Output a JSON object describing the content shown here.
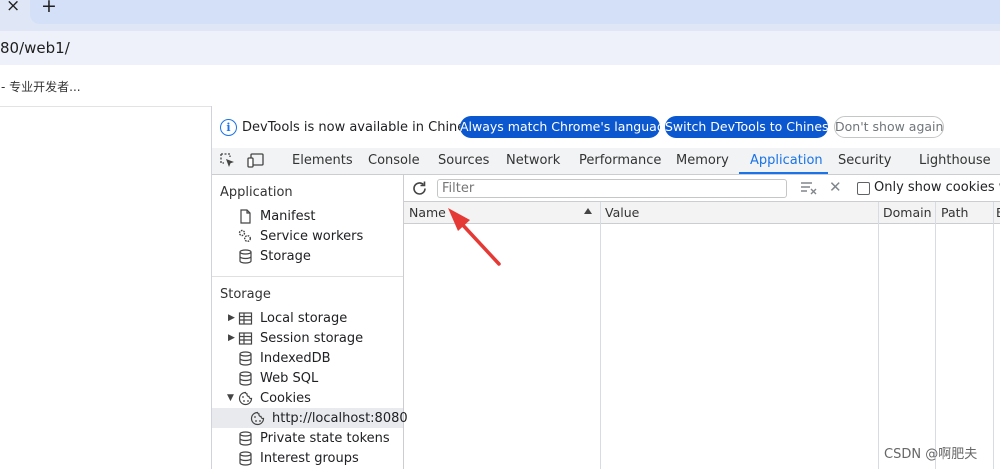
{
  "browser": {
    "tab_close": "×",
    "new_tab": "+",
    "url": "80/web1/",
    "bookmark": "- 专业开发者..."
  },
  "infobar": {
    "message": "DevTools is now available in Chinese!",
    "match_button": "Always match Chrome's language",
    "switch_button": "Switch DevTools to Chinese",
    "dont_show_button": "Don't show again"
  },
  "tabs": [
    "Elements",
    "Console",
    "Sources",
    "Network",
    "Performance",
    "Memory",
    "Application",
    "Security",
    "Lighthouse"
  ],
  "active_tab": "Application",
  "sidebar": {
    "application_title": "Application",
    "application_items": [
      "Manifest",
      "Service workers",
      "Storage"
    ],
    "storage_title": "Storage",
    "storage_items": [
      "Local storage",
      "Session storage",
      "IndexedDB",
      "Web SQL",
      "Cookies",
      "http://localhost:8080",
      "Private state tokens",
      "Interest groups"
    ]
  },
  "toolbar": {
    "filter_placeholder": "Filter",
    "only_show_label": "Only show cookies wit"
  },
  "grid": {
    "columns": [
      "Name",
      "Value",
      "Domain",
      "Path",
      "E"
    ]
  },
  "watermark": "CSDN @啊肥夫",
  "colors": {
    "accent": "#1a73e8",
    "button": "#0b57d0",
    "annotation_arrow": "#e53935"
  }
}
